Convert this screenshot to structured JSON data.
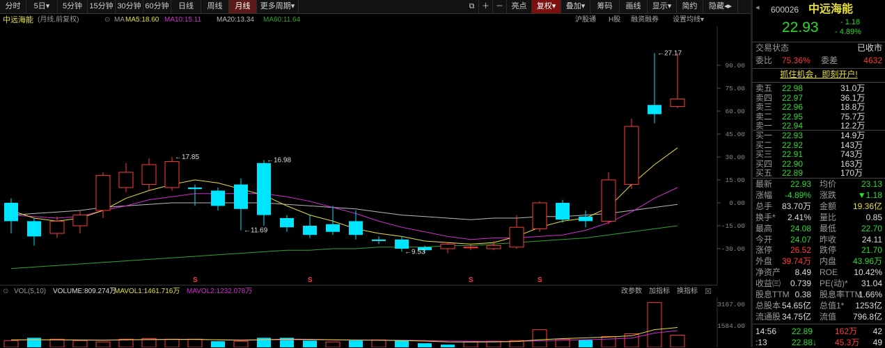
{
  "toolbar": {
    "tabs": [
      "分时",
      "5日▾",
      "5分钟",
      "15分钟",
      "30分钟",
      "60分钟",
      "日线",
      "周线",
      "月线",
      "更多周期▾"
    ],
    "active_tab": "月线",
    "right_buttons": [
      "亮点",
      "复权▾",
      "叠加▾",
      "筹码",
      "画线",
      "显示▾",
      "简约",
      "隐藏◂▸"
    ],
    "icons": [
      "⧉",
      "＋",
      "－"
    ]
  },
  "infobar": {
    "stock_name": "中远海能",
    "mode": "(月线,前复权)",
    "ma_label": "MA",
    "ma5": "MA5:18.60",
    "ma10": "MA10:15.11",
    "ma20": "MA20:13.34",
    "ma60": "MA60:11.64",
    "links": [
      "沪股通",
      "H股",
      "融资融券",
      "设置均线▾"
    ]
  },
  "main_chart": {
    "y_ticks": [
      "90.00",
      "75.00",
      "60.00",
      "45.00",
      "30.00",
      "15.00",
      "0.00",
      "-15.00",
      "-30.00"
    ],
    "annotations": [
      "27.17",
      "17.85",
      "16.98",
      "11.69",
      "9.53"
    ],
    "s_marks": [
      "S",
      "S",
      "S",
      "S"
    ]
  },
  "volume": {
    "label": "VOL(5,10)",
    "volume": "VOLUME:809.274万",
    "mavol1": "MAVOL1:1461.716万",
    "mavol2": "MAVOL2:1232.078万",
    "buttons": [
      "改参数",
      "加指标",
      "换指标"
    ],
    "y_ticks": [
      "3167.00",
      "1584.00"
    ]
  },
  "panel": {
    "code": "600026",
    "name": "中远海能",
    "price": "22.93",
    "change": "- 1.18",
    "change_pct": "- 4.89%",
    "status_label": "交易状态",
    "status_value": "已收市",
    "weibi_label": "委比",
    "weibi_value": "75.36%",
    "weicha_label": "委差",
    "weicha_value": "4632",
    "promo": "抓住机会，即刻开户!",
    "asks": [
      {
        "label": "卖五",
        "price": "22.98",
        "vol": "31.0万"
      },
      {
        "label": "卖四",
        "price": "22.97",
        "vol": "36.1万"
      },
      {
        "label": "卖三",
        "price": "22.96",
        "vol": "18.8万"
      },
      {
        "label": "卖二",
        "price": "22.95",
        "vol": "75.7万"
      },
      {
        "label": "卖一",
        "price": "22.94",
        "vol": "12.2万"
      }
    ],
    "bids": [
      {
        "label": "买一",
        "price": "22.93",
        "vol": "14.9万"
      },
      {
        "label": "买二",
        "price": "22.92",
        "vol": "143万"
      },
      {
        "label": "买三",
        "price": "22.91",
        "vol": "743万"
      },
      {
        "label": "买四",
        "price": "22.90",
        "vol": "163万"
      },
      {
        "label": "买五",
        "price": "22.89",
        "vol": "170万"
      }
    ],
    "stats": [
      {
        "l1": "最新",
        "v1": "22.93",
        "c1": "green",
        "l2": "均价",
        "v2": "23.13",
        "c2": "green"
      },
      {
        "l1": "涨幅",
        "v1": "-4.89%",
        "c1": "green",
        "l2": "涨跌",
        "v2": "▼1.18",
        "c2": "green"
      },
      {
        "l1": "总手",
        "v1": "83.70万",
        "c1": "white",
        "l2": "金额",
        "v2": "19.36亿",
        "c2": "yellow"
      },
      {
        "l1": "换手*",
        "v1": "2.41%",
        "c1": "white",
        "l2": "量比",
        "v2": "0.85",
        "c2": "white"
      },
      {
        "l1": "最高",
        "v1": "24.08",
        "c1": "green",
        "l2": "最低",
        "v2": "22.70",
        "c2": "green"
      },
      {
        "l1": "今开",
        "v1": "24.07",
        "c1": "green",
        "l2": "昨收",
        "v2": "24.11",
        "c2": "white"
      },
      {
        "l1": "涨停",
        "v1": "26.52",
        "c1": "red",
        "l2": "跌停",
        "v2": "21.70",
        "c2": "green"
      },
      {
        "l1": "外盘",
        "v1": "39.74万",
        "c1": "red",
        "l2": "内盘",
        "v2": "43.96万",
        "c2": "green"
      },
      {
        "l1": "净资产",
        "v1": "8.49",
        "c1": "white",
        "l2": "ROE",
        "v2": "10.42%",
        "c2": "white"
      },
      {
        "l1": "收益㈢",
        "v1": "0.739",
        "c1": "white",
        "l2": "PE(动)*",
        "v2": "31.04",
        "c2": "white"
      },
      {
        "l1": "股息TTM",
        "v1": "0.38",
        "c1": "white",
        "l2": "股息率TTM",
        "v2": "1.66%",
        "c2": "white"
      },
      {
        "l1": "总股本",
        "v1": "54.65亿",
        "c1": "white",
        "l2": "总值1*",
        "v2": "1253亿",
        "c2": "white"
      },
      {
        "l1": "流通股",
        "v1": "34.75亿",
        "c1": "white",
        "l2": "流值",
        "v2": "796.8亿",
        "c2": "white"
      }
    ],
    "ticks": [
      {
        "time": "14:56",
        "price": "22.89",
        "vol": "162万",
        "num": "42"
      },
      {
        "time": ":13",
        "price": "22.88↓",
        "vol": "45.3万",
        "num": "49"
      }
    ]
  },
  "colors": {
    "up": "#ff3b3b",
    "down": "#00e5ff",
    "ma5": "#e8e03a",
    "ma10": "#d42cd4",
    "ma20": "#bbbbbb",
    "ma60": "#2fa52f"
  },
  "chart_data": {
    "type": "candlestick",
    "series": [
      {
        "o": 0,
        "c": -12,
        "h": 3,
        "l": -20
      },
      {
        "o": -12,
        "c": -22,
        "h": -10,
        "l": -28
      },
      {
        "o": -20,
        "c": -12,
        "h": -9,
        "l": -23
      },
      {
        "o": -15,
        "c": -8,
        "h": -5,
        "l": -20
      },
      {
        "o": -5,
        "c": 18,
        "h": 20,
        "l": -10
      },
      {
        "o": 10,
        "c": 20,
        "h": 26,
        "l": 7
      },
      {
        "o": 12,
        "c": 25,
        "h": 29,
        "l": 8
      },
      {
        "o": 10,
        "c": 27,
        "h": 30,
        "l": 8
      },
      {
        "o": 10,
        "c": 9,
        "h": 12,
        "l": -2
      },
      {
        "o": 8,
        "c": -2,
        "h": 10,
        "l": -5
      },
      {
        "o": 12,
        "c": -4,
        "h": 16,
        "l": -18
      },
      {
        "o": 26,
        "c": -8,
        "h": 28,
        "l": -15
      },
      {
        "o": -10,
        "c": -16,
        "h": -8,
        "l": -19
      },
      {
        "o": -15,
        "c": -21,
        "h": -8,
        "l": -23
      },
      {
        "o": -14,
        "c": -19,
        "h": -2,
        "l": -21
      },
      {
        "o": -12,
        "c": -21,
        "h": -5,
        "l": -24
      },
      {
        "o": -24,
        "c": -25,
        "h": -22,
        "l": -27
      },
      {
        "o": -24,
        "c": -30,
        "h": -22,
        "l": -32
      },
      {
        "o": -29,
        "c": -31,
        "h": -28,
        "l": -33
      },
      {
        "o": -30,
        "c": -27,
        "h": -26,
        "l": -33
      },
      {
        "o": -29,
        "c": -29,
        "h": -27,
        "l": -31
      },
      {
        "o": -30,
        "c": -28,
        "h": -25,
        "l": -31
      },
      {
        "o": -29,
        "c": -16,
        "h": -8,
        "l": -30
      },
      {
        "o": -17,
        "c": 0,
        "h": 1,
        "l": -19
      },
      {
        "o": 0,
        "c": -11,
        "h": 2,
        "l": -13
      },
      {
        "o": -9,
        "c": -12,
        "h": -5,
        "l": -16
      },
      {
        "o": -12,
        "c": 15,
        "h": 20,
        "l": -14
      },
      {
        "o": 12,
        "c": 50,
        "h": 55,
        "l": 9
      },
      {
        "o": 64,
        "c": 58,
        "h": 98,
        "l": 52
      },
      {
        "o": 63,
        "c": 68,
        "h": 98,
        "l": 62
      }
    ],
    "ma5": [
      -5,
      -10,
      -12,
      -10,
      -5,
      3,
      8,
      12,
      15,
      13,
      9,
      5,
      -2,
      -8,
      -12,
      -17,
      -20,
      -22,
      -25,
      -26,
      -27,
      -26,
      -22,
      -16,
      -12,
      -10,
      -3,
      12,
      25,
      36
    ],
    "ma10": [
      -8,
      -9,
      -10,
      -9,
      -5,
      -2,
      2,
      4,
      6,
      6,
      6,
      6,
      4,
      1,
      -3,
      -7,
      -12,
      -16,
      -19,
      -22,
      -24,
      -23,
      -23,
      -22,
      -21,
      -18,
      -13,
      -6,
      3,
      10
    ],
    "ma20": [
      -8,
      -7,
      -6,
      -5,
      -3,
      -2,
      -1,
      0,
      0,
      0,
      0,
      0,
      -1,
      -2,
      -3,
      -4,
      -6,
      -8,
      -9,
      -10,
      -11,
      -10,
      -10,
      -9,
      -9,
      -8,
      -7,
      -5,
      -3,
      -1
    ],
    "ma60": [
      -43,
      -42,
      -41,
      -40,
      -39,
      -38,
      -37,
      -36,
      -35,
      -34,
      -33,
      -32,
      -31,
      -31,
      -30,
      -30,
      -29,
      -29,
      -29,
      -28,
      -28,
      -27,
      -26,
      -25,
      -24,
      -23,
      -21,
      -19,
      -17,
      -15
    ],
    "volumes": [
      500,
      700,
      600,
      500,
      400,
      600,
      650,
      600,
      600,
      450,
      450,
      700,
      700,
      500,
      400,
      500,
      550,
      500,
      300,
      200,
      400,
      450,
      500,
      1300,
      600,
      550,
      800,
      1000,
      3300,
      900
    ],
    "volume_up": [
      true,
      false,
      true,
      true,
      true,
      true,
      true,
      true,
      true,
      false,
      true,
      false,
      false,
      false,
      true,
      false,
      true,
      false,
      false,
      false,
      true,
      true,
      true,
      true,
      true,
      false,
      true,
      true,
      true,
      true
    ],
    "mavol1": [
      550,
      560,
      550,
      540,
      520,
      560,
      580,
      590,
      590,
      560,
      520,
      560,
      600,
      590,
      560,
      540,
      520,
      500,
      460,
      400,
      390,
      400,
      430,
      560,
      640,
      700,
      760,
      850,
      1300,
      1461
    ],
    "mavol2": [
      540,
      550,
      550,
      545,
      540,
      550,
      560,
      570,
      570,
      560,
      545,
      550,
      560,
      560,
      550,
      540,
      530,
      520,
      500,
      470,
      450,
      440,
      440,
      480,
      520,
      560,
      610,
      680,
      1050,
      1232
    ]
  }
}
